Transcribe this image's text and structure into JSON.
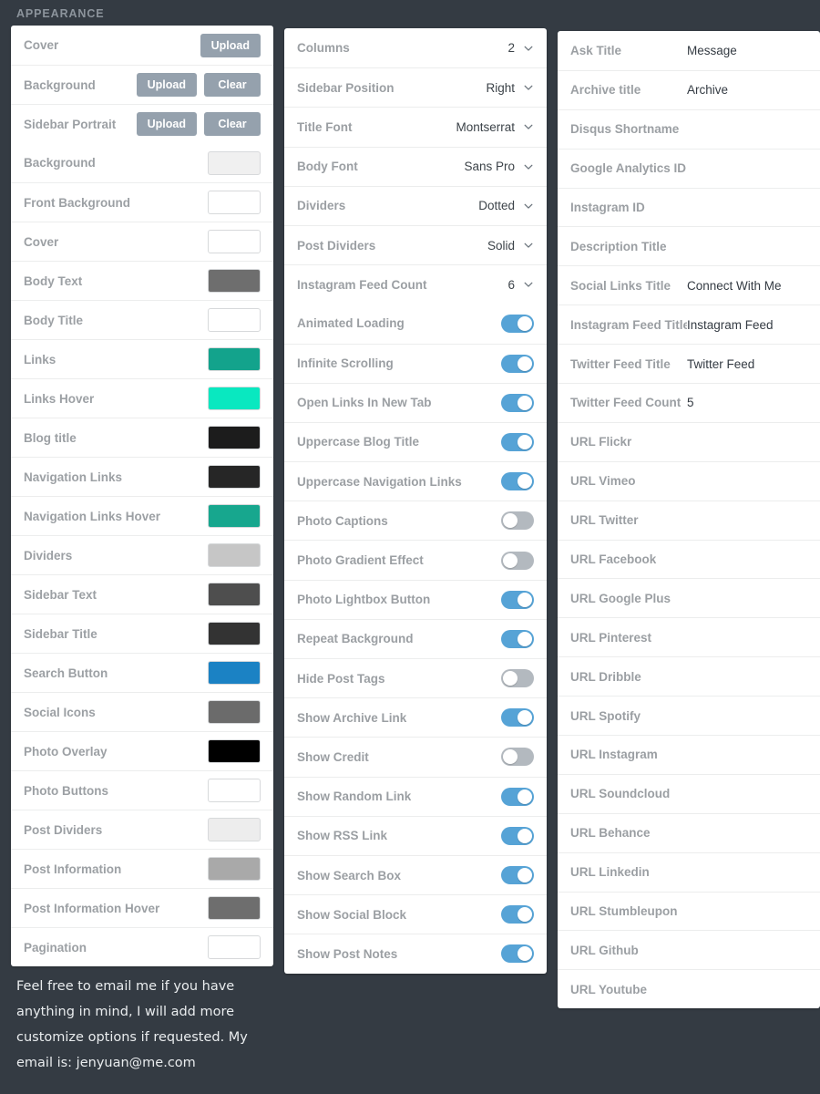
{
  "header": {
    "title": "APPEARANCE"
  },
  "colors": {
    "page_background": "#343b43",
    "panel_background": "#ffffff",
    "button_gray": "#95a1ad",
    "toggle_on": "#56a3d6",
    "toggle_off": "#b3b9bf",
    "label_gray": "#9b9fa3"
  },
  "left_column": {
    "upload_rows": [
      {
        "label": "Cover",
        "buttons": [
          "Upload"
        ]
      },
      {
        "label": "Background",
        "buttons": [
          "Upload",
          "Clear"
        ]
      },
      {
        "label": "Sidebar Portrait",
        "buttons": [
          "Upload",
          "Clear"
        ]
      }
    ],
    "color_rows": [
      {
        "label": "Background",
        "value": "#f0f0f0"
      },
      {
        "label": "Front Background",
        "value": "#ffffff"
      },
      {
        "label": "Cover",
        "value": "#ffffff"
      },
      {
        "label": "Body Text",
        "value": "#6e6e6e"
      },
      {
        "label": "Body Title",
        "value": "#ffffff"
      },
      {
        "label": "Links",
        "value": "#13a38c"
      },
      {
        "label": "Links Hover",
        "value": "#09e8c0"
      },
      {
        "label": "Blog title",
        "value": "#1c1c1c"
      },
      {
        "label": "Navigation Links",
        "value": "#262626"
      },
      {
        "label": "Navigation Links Hover",
        "value": "#17a78e"
      },
      {
        "label": "Dividers",
        "value": "#c6c6c6"
      },
      {
        "label": "Sidebar Text",
        "value": "#4e4e4e"
      },
      {
        "label": "Sidebar Title",
        "value": "#333333"
      },
      {
        "label": "Search Button",
        "value": "#1b82c4"
      },
      {
        "label": "Social Icons",
        "value": "#6b6b6b"
      },
      {
        "label": "Photo Overlay",
        "value": "#000000"
      },
      {
        "label": "Photo Buttons",
        "value": "#ffffff"
      },
      {
        "label": "Post Dividers",
        "value": "#ededed"
      },
      {
        "label": "Post Information",
        "value": "#a9a9a9"
      },
      {
        "label": "Post Information Hover",
        "value": "#6e6e6e"
      },
      {
        "label": "Pagination",
        "value": "#ffffff"
      }
    ]
  },
  "middle_column": {
    "selects": [
      {
        "label": "Columns",
        "value": "2"
      },
      {
        "label": "Sidebar Position",
        "value": "Right"
      },
      {
        "label": "Title Font",
        "value": "Montserrat"
      },
      {
        "label": "Body Font",
        "value": "Sans Pro"
      },
      {
        "label": "Dividers",
        "value": "Dotted"
      },
      {
        "label": "Post Dividers",
        "value": "Solid"
      },
      {
        "label": "Instagram Feed Count",
        "value": "6"
      }
    ],
    "toggles": [
      {
        "label": "Animated Loading",
        "on": true
      },
      {
        "label": "Infinite Scrolling",
        "on": true
      },
      {
        "label": "Open Links In New Tab",
        "on": true
      },
      {
        "label": "Uppercase Blog Title",
        "on": true
      },
      {
        "label": "Uppercase Navigation Links",
        "on": true
      },
      {
        "label": "Photo Captions",
        "on": false
      },
      {
        "label": "Photo Gradient Effect",
        "on": false
      },
      {
        "label": "Photo Lightbox Button",
        "on": true
      },
      {
        "label": "Repeat Background",
        "on": true
      },
      {
        "label": "Hide Post Tags",
        "on": false
      },
      {
        "label": "Show Archive Link",
        "on": true
      },
      {
        "label": "Show Credit",
        "on": false
      },
      {
        "label": "Show Random Link",
        "on": true
      },
      {
        "label": "Show RSS Link",
        "on": true
      },
      {
        "label": "Show Search Box",
        "on": true
      },
      {
        "label": "Show Social Block",
        "on": true
      },
      {
        "label": "Show Post Notes",
        "on": true
      }
    ]
  },
  "right_column": {
    "fields": [
      {
        "label": "Ask Title",
        "value": "Message"
      },
      {
        "label": "Archive title",
        "value": "Archive"
      },
      {
        "label": "Disqus Shortname",
        "value": ""
      },
      {
        "label": "Google Analytics ID",
        "value": ""
      },
      {
        "label": "Instagram ID",
        "value": ""
      },
      {
        "label": "Description Title",
        "value": ""
      },
      {
        "label": "Social Links Title",
        "value": "Connect With Me"
      },
      {
        "label": "Instagram Feed Title",
        "value": "Instagram Feed"
      },
      {
        "label": "Twitter Feed Title",
        "value": "Twitter Feed"
      },
      {
        "label": "Twitter Feed Count",
        "value": "5"
      },
      {
        "label": "URL Flickr",
        "value": ""
      },
      {
        "label": "URL Vimeo",
        "value": ""
      },
      {
        "label": "URL Twitter",
        "value": ""
      },
      {
        "label": "URL Facebook",
        "value": ""
      },
      {
        "label": "URL Google Plus",
        "value": ""
      },
      {
        "label": "URL Pinterest",
        "value": ""
      },
      {
        "label": "URL Dribble",
        "value": ""
      },
      {
        "label": "URL Spotify",
        "value": ""
      },
      {
        "label": "URL Instagram",
        "value": ""
      },
      {
        "label": "URL Soundcloud",
        "value": ""
      },
      {
        "label": "URL Behance",
        "value": ""
      },
      {
        "label": "URL Linkedin",
        "value": ""
      },
      {
        "label": "URL Stumbleupon",
        "value": ""
      },
      {
        "label": "URL Github",
        "value": ""
      },
      {
        "label": "URL Youtube",
        "value": ""
      }
    ]
  },
  "footer": {
    "note": "Feel free to email me if you have anything in mind, I will add more customize options if requested. My email is: jenyuan@me.com"
  }
}
